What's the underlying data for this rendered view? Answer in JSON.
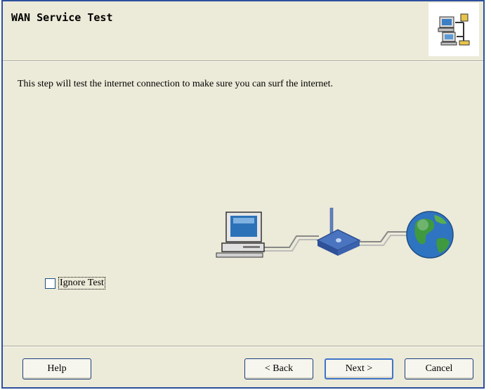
{
  "header": {
    "title": "WAN Service Test",
    "icon": "network-wizard-icon"
  },
  "main": {
    "description": "This step will test the internet connection to make sure you can surf the internet.",
    "illustration": [
      "computer-icon",
      "router-icon",
      "globe-icon"
    ],
    "ignore_test_label": "Ignore Test",
    "ignore_test_checked": false
  },
  "buttons": {
    "help": "Help",
    "back": "< Back",
    "next": "Next >",
    "cancel": "Cancel"
  },
  "colors": {
    "dialog_bg": "#ecead8",
    "frame": "#2d4f9e",
    "button_border": "#1c3f7a"
  }
}
